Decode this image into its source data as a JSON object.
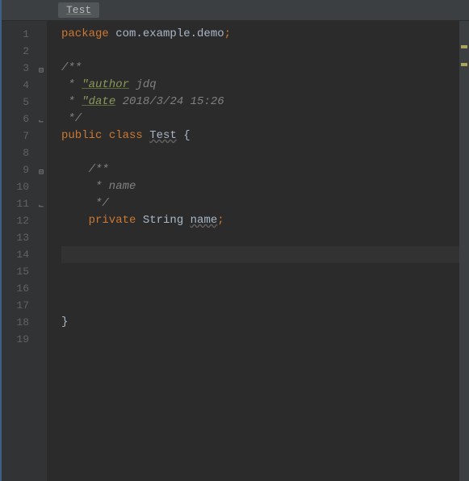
{
  "tab": {
    "label": "Test"
  },
  "lines": {
    "count": 19,
    "current": 14
  },
  "code": {
    "l1_kw": "package",
    "l1_pkg": " com.example.demo",
    "l1_semi": ";",
    "l3": "/**",
    "l4_pre": " * ",
    "l4_tag": "\"author",
    "l4_val": " jdq",
    "l5_pre": " * ",
    "l5_tag": "\"date",
    "l5_val": " 2018/3/24 15:26",
    "l6": " */",
    "l7_kw1": "public",
    "l7_kw2": " class ",
    "l7_name": "Test",
    "l7_brace": " {",
    "l9": "    /**",
    "l10": "     * name",
    "l11": "     */",
    "l12_kw": "    private ",
    "l12_type": "String ",
    "l12_name": "name",
    "l12_semi": ";",
    "l18": "}"
  }
}
